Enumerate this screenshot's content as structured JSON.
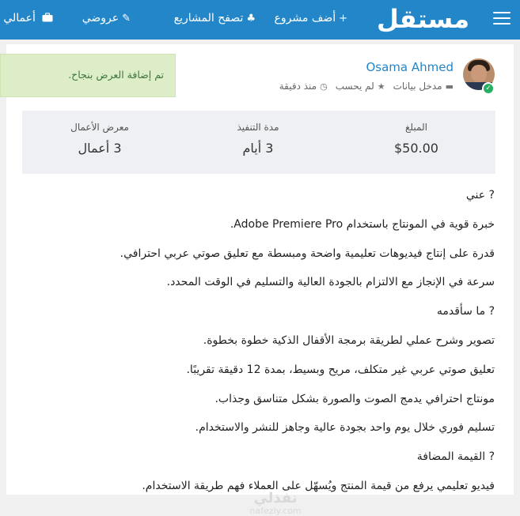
{
  "brand": {
    "logo_text": "مستقل"
  },
  "nav": {
    "add_project": "أضف مشروع",
    "add_project_icon": "+",
    "browse_projects": "تصفح المشاريع",
    "browse_projects_icon": "♣",
    "my_offers": "عروضي",
    "my_offers_icon": "✎",
    "my_works": "أعمالي",
    "my_works_icon": "briefcase-icon"
  },
  "profile": {
    "name": "Osama Ahmed",
    "role": "مدخل بيانات",
    "status": "لم يحسب",
    "time": "منذ دقيقة"
  },
  "alert": {
    "message": "تم إضافة العرض بنجاح."
  },
  "stats": {
    "amount_label": "المبلغ",
    "amount_value": "$50.00",
    "duration_label": "مدة التنفيذ",
    "duration_value": "3 أيام",
    "portfolio_label": "معرض الأعمال",
    "portfolio_value": "3 أعمال"
  },
  "description": {
    "lines": [
      "? عني",
      "خبرة قوية في المونتاج باستخدام Adobe Premiere Pro.",
      "قدرة على إنتاج فيديوهات تعليمية واضحة ومبسطة مع تعليق صوتي عربي احترافي.",
      "سرعة في الإنجاز مع الالتزام بالجودة العالية والتسليم في الوقت المحدد.",
      "? ما سأقدمه",
      "تصوير وشرح عملي لطريقة برمجة الأقفال الذكية خطوة بخطوة.",
      "تعليق صوتي عربي غير متكلف، مريح وبسيط، بمدة 12 دقيقة تقريبًا.",
      "مونتاج احترافي يدمج الصوت والصورة بشكل متناسق وجذاب.",
      "تسليم فوري خلال يوم واحد بجودة عالية وجاهز للنشر والاستخدام.",
      "? القيمة المضافة",
      "فيديو تعليمي يرفع من قيمة المنتج ويُسهّل على العملاء فهم طريقة الاستخدام."
    ]
  },
  "watermark": {
    "arabic": "نفذلي",
    "latin": "nafezly.com"
  }
}
